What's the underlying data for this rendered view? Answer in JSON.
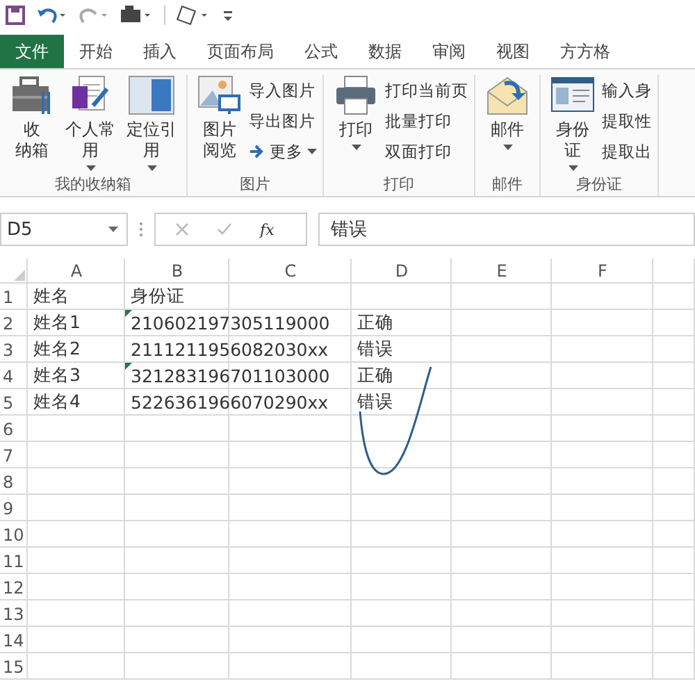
{
  "tabs": [
    {
      "label": "文件",
      "selected": true
    },
    {
      "label": "开始",
      "selected": false
    },
    {
      "label": "插入",
      "selected": false
    },
    {
      "label": "页面布局",
      "selected": false
    },
    {
      "label": "公式",
      "selected": false
    },
    {
      "label": "数据",
      "selected": false
    },
    {
      "label": "审阅",
      "selected": false
    },
    {
      "label": "视图",
      "selected": false
    },
    {
      "label": "方方格",
      "selected": false
    }
  ],
  "ribbon_groups": [
    {
      "label": "我的收纳箱",
      "large": [
        {
          "lines": [
            "收",
            "纳箱"
          ],
          "dropdown": false
        },
        {
          "lines": [
            "个人常",
            "用"
          ],
          "dropdown": true
        },
        {
          "lines": [
            "定位引",
            "用"
          ],
          "dropdown": true
        }
      ]
    },
    {
      "label": "图片",
      "large": [
        {
          "lines": [
            "图片",
            "阅览"
          ],
          "dropdown": false
        }
      ],
      "small": [
        {
          "label": "导入图片",
          "arrow": false,
          "dropdown": false
        },
        {
          "label": "导出图片",
          "arrow": false,
          "dropdown": false
        },
        {
          "label": "更多",
          "arrow": true,
          "dropdown": true
        }
      ]
    },
    {
      "label": "打印",
      "large": [
        {
          "lines": [
            "打印"
          ],
          "dropdown": true
        }
      ],
      "small": [
        {
          "label": "打印当前页",
          "arrow": false,
          "dropdown": false
        },
        {
          "label": "批量打印",
          "arrow": false,
          "dropdown": false
        },
        {
          "label": "双面打印",
          "arrow": false,
          "dropdown": false
        }
      ]
    },
    {
      "label": "邮件",
      "large": [
        {
          "lines": [
            "邮件"
          ],
          "dropdown": true
        }
      ]
    },
    {
      "label": "身份证",
      "large": [
        {
          "lines": [
            "身份",
            "证"
          ],
          "dropdown": true
        }
      ],
      "small": [
        {
          "label": "输入身",
          "arrow": false,
          "dropdown": false
        },
        {
          "label": "提取性",
          "arrow": false,
          "dropdown": false
        },
        {
          "label": "提取出",
          "arrow": false,
          "dropdown": false
        }
      ]
    }
  ],
  "formula_bar": {
    "name_box": "D5",
    "fx": "fx",
    "value": "错误"
  },
  "columns": [
    "A",
    "B",
    "C",
    "D",
    "E",
    "F"
  ],
  "rows": [
    {
      "number": "1",
      "name": "姓名",
      "id": "身份证",
      "id_flag": false,
      "result": ""
    },
    {
      "number": "2",
      "name": "姓名1",
      "id": "210602197305119000",
      "id_flag": true,
      "result": "正确"
    },
    {
      "number": "3",
      "name": "姓名2",
      "id": "2111211956082030xx",
      "id_flag": false,
      "result": "错误"
    },
    {
      "number": "4",
      "name": "姓名3",
      "id": "321283196701103000",
      "id_flag": true,
      "result": "正确"
    },
    {
      "number": "5",
      "name": "姓名4",
      "id": "5226361966070290xx",
      "id_flag": false,
      "result": "错误"
    }
  ],
  "empty_rows": [
    "6",
    "7",
    "8",
    "9",
    "10",
    "11",
    "12",
    "13",
    "14",
    "15"
  ]
}
